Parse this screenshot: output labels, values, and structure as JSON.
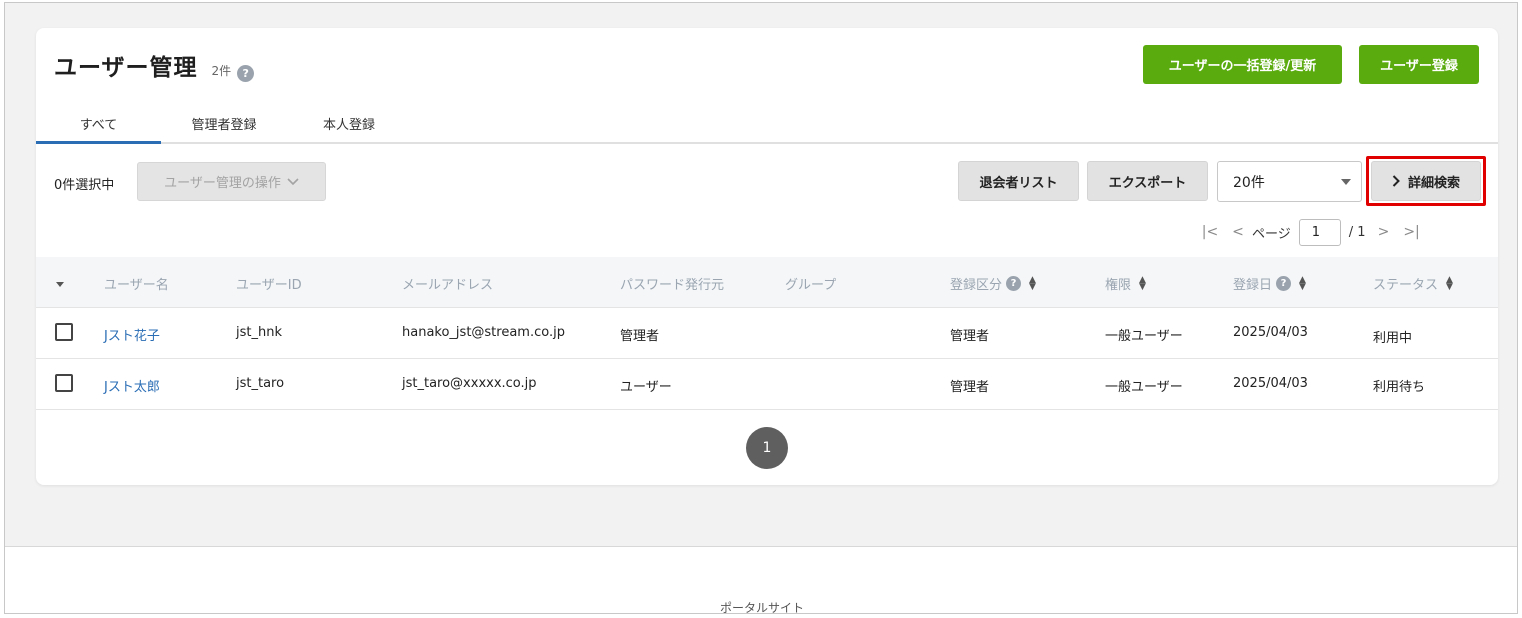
{
  "header": {
    "title": "ユーザー管理",
    "count": "2件",
    "help_icon": "?",
    "bulk_button": "ユーザーの一括登録/更新",
    "register_button": "ユーザー登録"
  },
  "tabs": [
    {
      "label": "すべて",
      "active": true
    },
    {
      "label": "管理者登録",
      "active": false
    },
    {
      "label": "本人登録",
      "active": false
    }
  ],
  "toolbar": {
    "selected_count": "0件選択中",
    "operations_label": "ユーザー管理の操作",
    "withdrawn_list": "退会者リスト",
    "export": "エクスポート",
    "page_size": "20件",
    "detail_search": "詳細検索",
    "detail_search_icon": "chevron-right-icon"
  },
  "pager": {
    "page_label": "ページ",
    "current_page": "1",
    "total_pages": "/ 1"
  },
  "table": {
    "columns": [
      "ユーザー名",
      "ユーザーID",
      "メールアドレス",
      "パスワード発行元",
      "グループ",
      "登録区分",
      "権限",
      "登録日",
      "ステータス"
    ],
    "rows": [
      {
        "name": "Jスト花子",
        "user_id": "jst_hnk",
        "email": "hanako_jst@stream.co.jp",
        "password_issuer": "管理者",
        "group": "",
        "registration_type": "管理者",
        "permission": "一般ユーザー",
        "registered_date": "2025/04/03",
        "status": "利用中"
      },
      {
        "name": "Jスト太郎",
        "user_id": "jst_taro",
        "email": "jst_taro@xxxxx.co.jp",
        "password_issuer": "ユーザー",
        "group": "",
        "registration_type": "管理者",
        "permission": "一般ユーザー",
        "registered_date": "2025/04/03",
        "status": "利用待ち"
      }
    ]
  },
  "bottom_pager": {
    "page": "1"
  },
  "footer": {
    "text": "ポータルサイト"
  },
  "colors": {
    "accent_green": "#5aab0e",
    "link_blue": "#2a6db5",
    "highlight_red": "#e00000"
  }
}
